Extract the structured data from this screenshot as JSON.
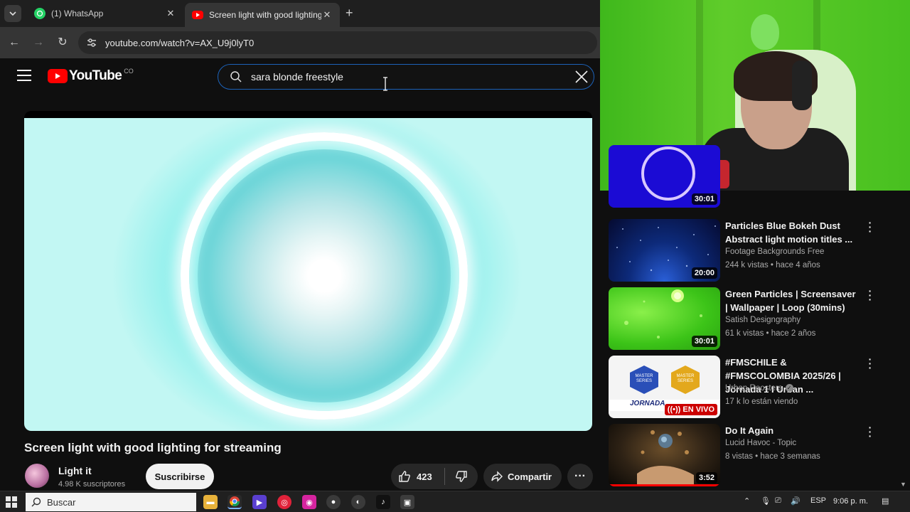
{
  "browser": {
    "tabs": [
      {
        "title": "(1) WhatsApp",
        "favicon": "whatsapp-icon",
        "color": "#25d366"
      },
      {
        "title": "Screen light with good lighting",
        "favicon": "youtube-icon",
        "color": "#ff0000"
      }
    ],
    "url": "youtube.com/watch?v=AX_U9j0lyT0"
  },
  "youtube": {
    "logo_text": "YouTube",
    "country_code": "CO",
    "search_query": "sara blonde freestyle"
  },
  "video": {
    "title": "Screen light with good lighting for streaming",
    "channel": "Light it",
    "subscribers": "4.98 K suscriptores",
    "subscribe_label": "Suscribirse",
    "likes": "423",
    "share_label": "Compartir"
  },
  "recommendations": [
    {
      "title": "",
      "channel": "",
      "meta": "",
      "duration": "30:01",
      "thumb": "purple-ring"
    },
    {
      "title": "Particles Blue Bokeh Dust Abstract light motion titles ...",
      "channel": "Footage Backgrounds Free",
      "meta": "244 k vistas • hace 4 años",
      "duration": "20:00",
      "thumb": "blue-particles"
    },
    {
      "title": "Green Particles | Screensaver | Wallpaper | Loop (30mins)",
      "channel": "Satish Designgraphy",
      "meta": "61 k vistas • hace 2 años",
      "duration": "30:01",
      "thumb": "green-particles"
    },
    {
      "title": "#FMSCHILE & #FMSCOLOMBIA 2025/26 | Jornada 1 I Urban ...",
      "channel": "Urban Roosters",
      "meta": "17 k lo están viendo",
      "duration": "EN VIVO",
      "thumb": "fms-master-series"
    },
    {
      "title": "Do It Again",
      "channel": "Lucid Havoc - Topic",
      "meta": "8 vistas • hace 3 semanas",
      "duration": "3:52",
      "thumb": "planet-art"
    }
  ],
  "thumb_texts": {
    "fms_badge_left": "MASTER SERIES",
    "fms_badge_right": "MASTER SERIES",
    "fms_strip": "JORNADA"
  },
  "taskbar": {
    "search_placeholder": "Buscar",
    "language": "ESP",
    "time": "9:06 p. m."
  }
}
